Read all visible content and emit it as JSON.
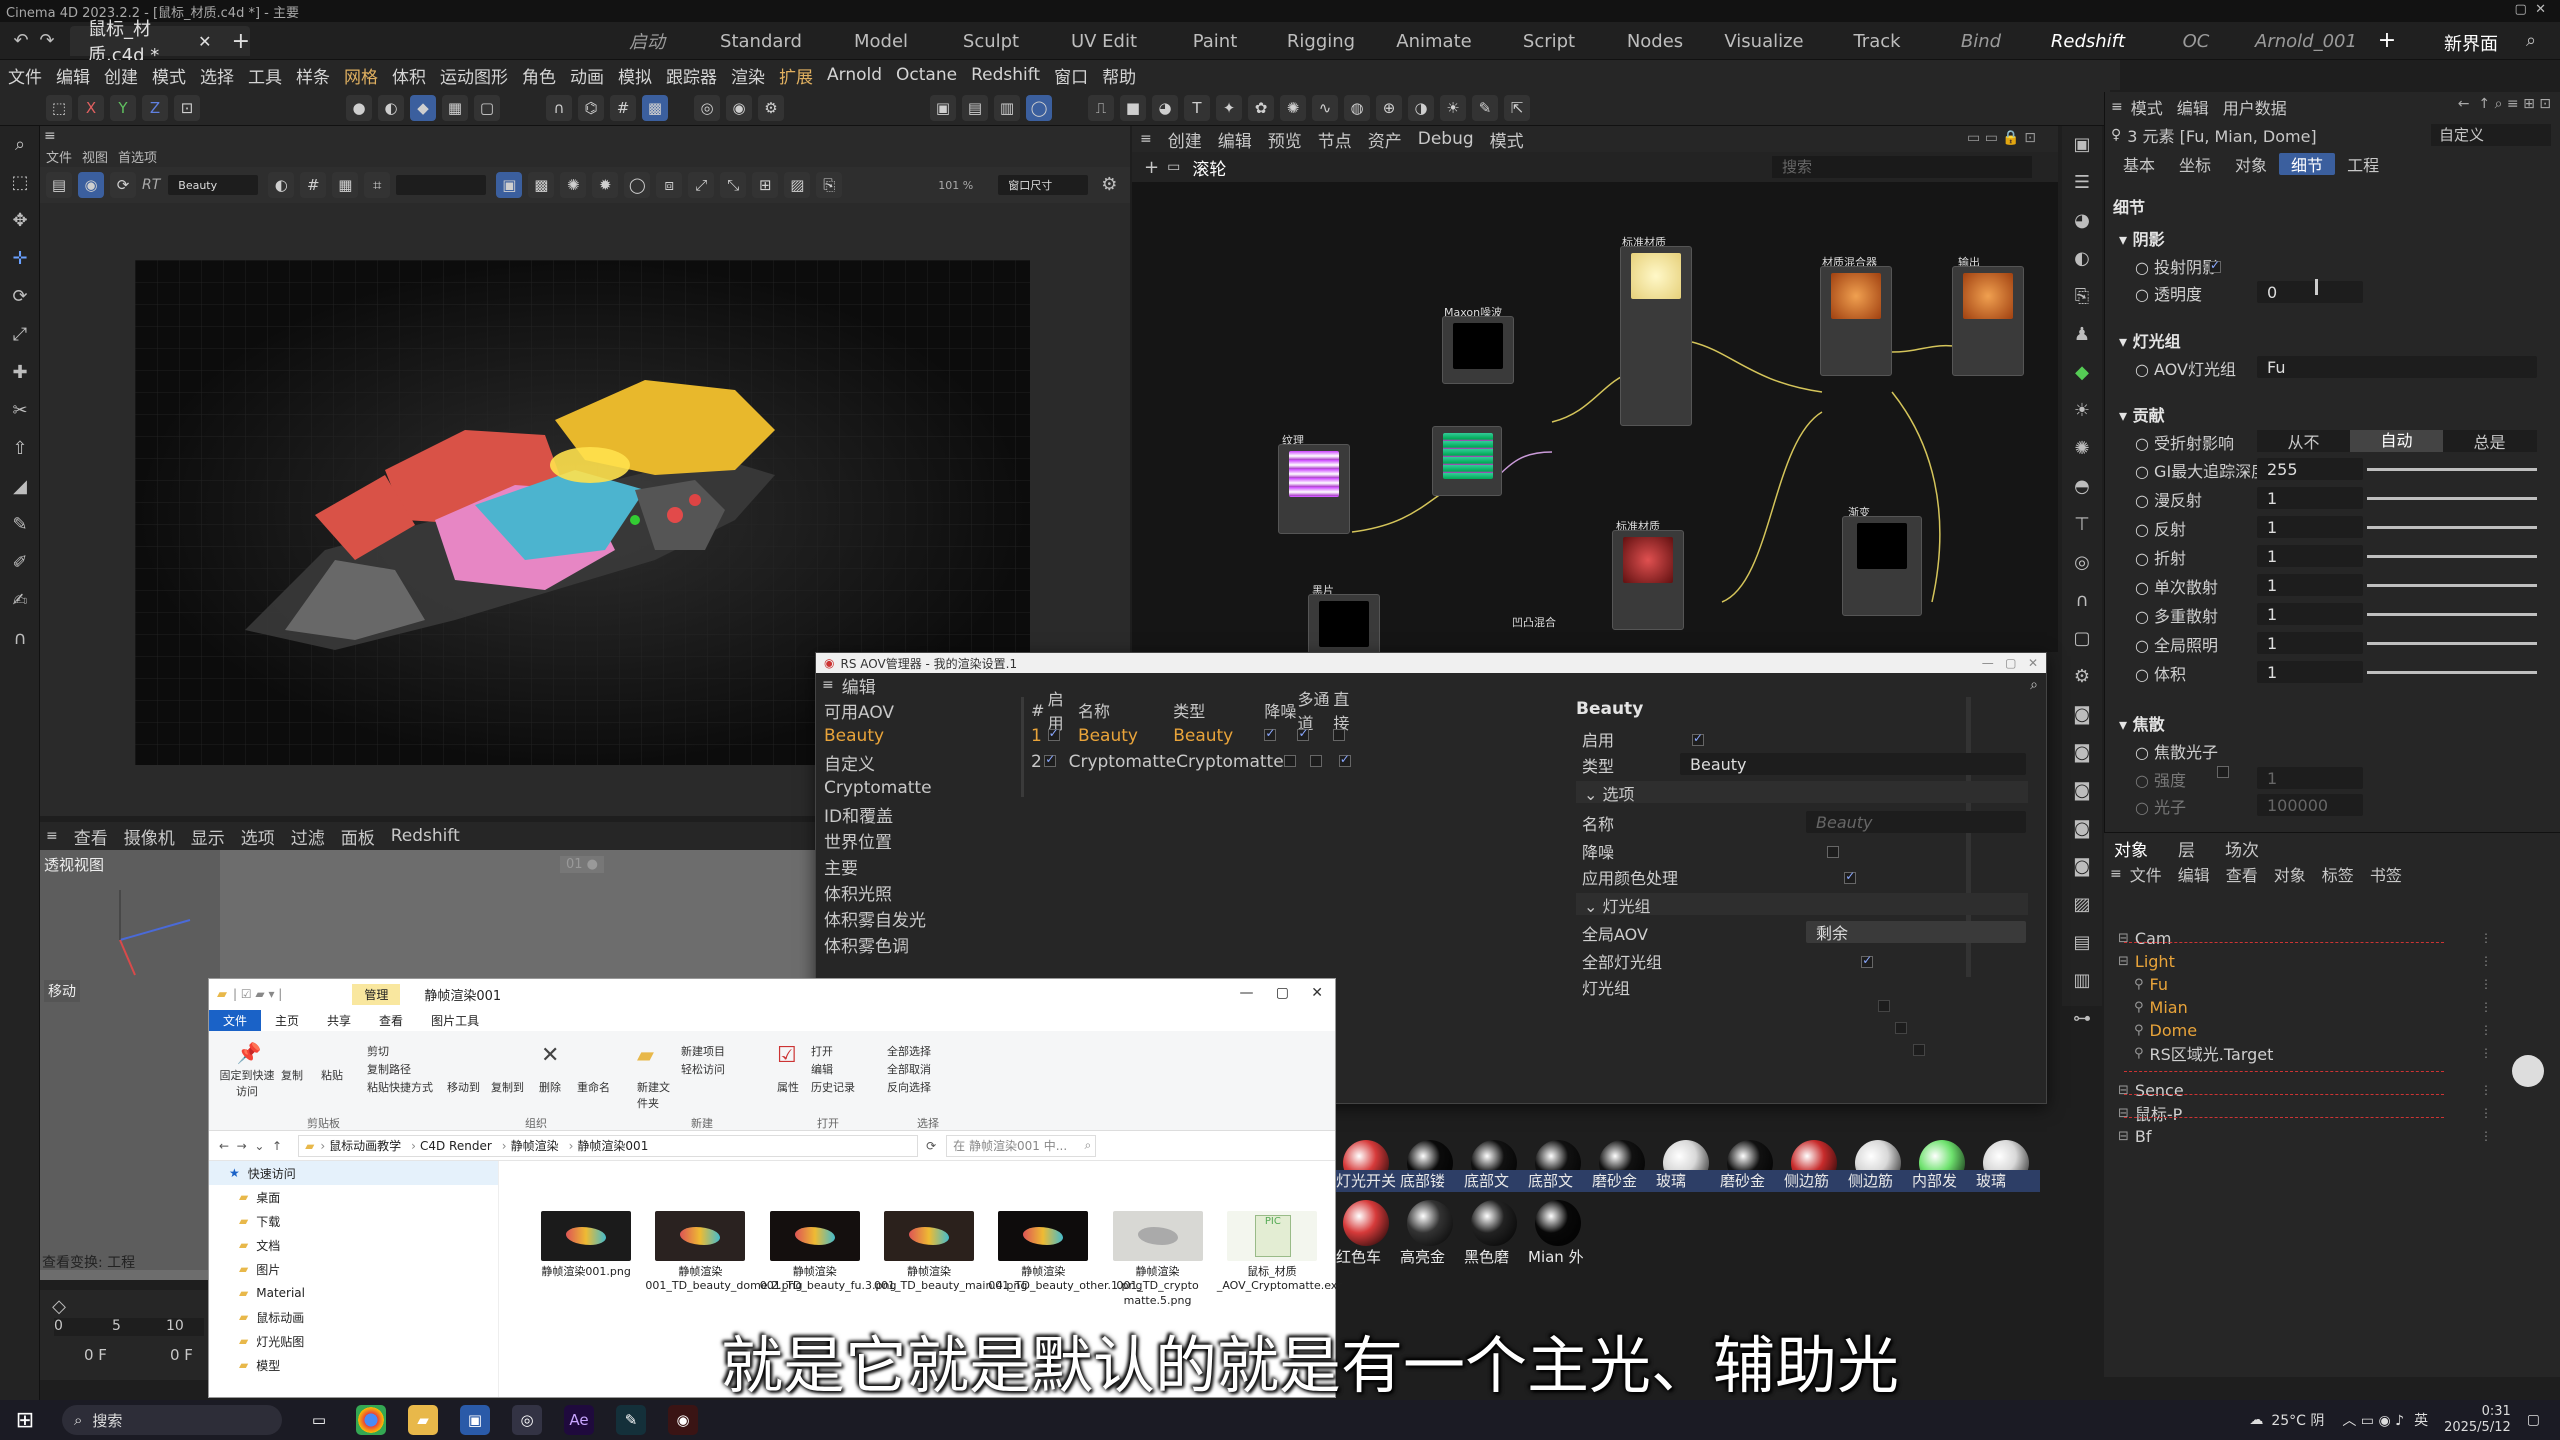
{
  "titlebar": {
    "text": "Cinema 4D 2023.2.2 - [鼠标_材质.c4d *] - 主要"
  },
  "document_tab": {
    "label": "鼠标_材质.c4d *"
  },
  "layouts": {
    "items": [
      "启动",
      "Standard",
      "Model",
      "Sculpt",
      "UV Edit",
      "Paint",
      "Rigging",
      "Animate",
      "Script",
      "Nodes",
      "Visualize",
      "Track",
      "Bind",
      "Redshift",
      "OC",
      "Arnold_001"
    ],
    "new_layout": "新界面"
  },
  "menubar": {
    "items": [
      "文件",
      "编辑",
      "创建",
      "模式",
      "选择",
      "工具",
      "样条",
      "网格",
      "体积",
      "运动图形",
      "角色",
      "动画",
      "模拟",
      "跟踪器",
      "渲染",
      "扩展",
      "Arnold",
      "Octane",
      "Redshift",
      "窗口",
      "帮助"
    ]
  },
  "toolbar1": {
    "axes": [
      "X",
      "Y",
      "Z"
    ]
  },
  "render_view": {
    "menu": [
      "文件",
      "视图",
      "首选项"
    ],
    "preset": "Beauty",
    "zoom": "101 %",
    "fit": "窗口尺寸"
  },
  "bottom_viewport": {
    "menu": [
      "查看",
      "摄像机",
      "显示",
      "选项",
      "过滤",
      "面板",
      "Redshift"
    ],
    "label": "透视视图",
    "move_label": "移动",
    "speed_label": "查看变换: 工程"
  },
  "node_editor": {
    "menu": [
      "创建",
      "编辑",
      "预览",
      "节点",
      "资产",
      "Debug",
      "模式"
    ],
    "tab": "滚轮",
    "search_placeholder": "搜索",
    "nodes": [
      "标准材质",
      "Maxon噪波",
      "材质混合器",
      "输出",
      "纹理",
      "标准材质",
      "渐变",
      "黑片",
      "凹凸混合"
    ]
  },
  "attr_panel": {
    "menu": [
      "模式",
      "编辑",
      "用户数据"
    ],
    "selection": "3 元素 [Fu, Mian, Dome]",
    "preset": "自定义",
    "tabs": [
      "基本",
      "坐标",
      "对象",
      "细节",
      "工程"
    ],
    "active_tab": "细节",
    "section_title": "细节",
    "shadow": {
      "title": "阴影",
      "cast_label": "投射阴影",
      "transparency_label": "透明度",
      "transparency_value": "0"
    },
    "light_group": {
      "title": "灯光组",
      "aov_label": "AOV灯光组",
      "aov_value": "Fu"
    },
    "contribution": {
      "title": "贡献",
      "gi_label": "受折射影响",
      "gi_options": [
        "从不",
        "自动",
        "总是"
      ],
      "gi_active": "自动",
      "rows": [
        {
          "label": "GI最大追踪深度",
          "value": "255"
        },
        {
          "label": "漫反射",
          "value": "1"
        },
        {
          "label": "反射",
          "value": "1"
        },
        {
          "label": "折射",
          "value": "1"
        },
        {
          "label": "单次散射",
          "value": "1"
        },
        {
          "label": "多重散射",
          "value": "1"
        },
        {
          "label": "全局照明",
          "value": "1"
        },
        {
          "label": "体积",
          "value": "1"
        }
      ]
    },
    "caustics": {
      "title": "焦散",
      "photon_label": "焦散光子",
      "intensity_label": "强度",
      "intensity_value": "1",
      "photons_label": "光子",
      "photons_value": "100000"
    }
  },
  "object_manager": {
    "tabs": [
      "对象",
      "层",
      "场次"
    ],
    "menu": [
      "文件",
      "编辑",
      "查看",
      "对象",
      "标签",
      "书签"
    ],
    "objects": [
      {
        "name": "Cam",
        "indent": 0,
        "color": "#cfcfcf"
      },
      {
        "name": "Light",
        "indent": 0,
        "color": "#e9a43a"
      },
      {
        "name": "Fu",
        "indent": 1,
        "color": "#e9a43a"
      },
      {
        "name": "Mian",
        "indent": 1,
        "color": "#e9a43a"
      },
      {
        "name": "Dome",
        "indent": 1,
        "color": "#e9a43a"
      },
      {
        "name": "RS区域光.Target",
        "indent": 1,
        "color": "#cfcfcf"
      },
      {
        "name": "Sence",
        "indent": 0,
        "color": "#cfcfcf"
      },
      {
        "name": "鼠标-P",
        "indent": 0,
        "color": "#cfcfcf"
      },
      {
        "name": "Bf",
        "indent": 0,
        "color": "#cfcfcf"
      }
    ]
  },
  "aov_dialog": {
    "title": "RS AOV管理器 - 我的渲染设置.1",
    "menu": "编辑",
    "available_header": "可用AOV",
    "available": [
      "Beauty",
      "自定义",
      "Cryptomatte",
      "ID和覆盖",
      "世界位置",
      "主要",
      "体积光照",
      "体积雾自发光",
      "体积雾色调"
    ],
    "columns": [
      "#",
      "启用",
      "名称",
      "类型",
      "降噪",
      "多通道",
      "直接"
    ],
    "rows": [
      {
        "num": "1",
        "name": "Beauty",
        "type": "Beauty"
      },
      {
        "num": "2",
        "name": "Cryptomatte",
        "type": "Cryptomatte"
      }
    ],
    "detail": {
      "title": "Beauty",
      "enabled_label": "启用",
      "type_label": "类型",
      "type_value": "Beauty",
      "options_label": "选项",
      "name_label": "名称",
      "name_placeholder": "Beauty",
      "denoise_label": "降噪",
      "color_label": "应用颜色处理",
      "lightgroups_label": "灯光组",
      "global_aov_label": "全局AOV",
      "global_aov_value": "剩余",
      "all_lightgroups_label": "全部灯光组",
      "lightgroup_label": "灯光组"
    }
  },
  "explorer": {
    "title": "静帧渲染001",
    "manage_tab": "管理",
    "tabs": [
      "文件",
      "主页",
      "共享",
      "查看",
      "图片工具"
    ],
    "ribbon_groups": [
      "剪贴板",
      "组织",
      "新建",
      "打开",
      "选择"
    ],
    "ribbon_buttons": [
      "固定到快速访问",
      "复制",
      "粘贴",
      "剪切",
      "复制路径",
      "粘贴快捷方式",
      "移动到",
      "复制到",
      "删除",
      "重命名",
      "新建文件夹",
      "新建项目",
      "轻松访问",
      "属性",
      "打开",
      "编辑",
      "历史记录",
      "全部选择",
      "全部取消",
      "反向选择"
    ],
    "path": [
      "鼠标动画教学",
      "C4D Render",
      "静帧渲染",
      "静帧渲染001"
    ],
    "search_placeholder": "在 静帧渲染001 中...",
    "sidebar": [
      "快速访问",
      "桌面",
      "下载",
      "文档",
      "图片",
      "Material",
      "鼠标动画",
      "灯光贴图",
      "模型"
    ],
    "files": [
      "静帧渲染001.png",
      "静帧渲染001_TD_beauty_dome.2.png",
      "静帧渲染001_TD_beauty_fu.3.png",
      "静帧渲染001_TD_beauty_main.4.png",
      "静帧渲染001_TD_beauty_other.1.png",
      "静帧渲染001_TD_crypto matte.5.png",
      "鼠标_材质_AOV_Cryptomatte.exr"
    ]
  },
  "materials": {
    "row1": [
      "灯光开关",
      "底部镂",
      "底部文",
      "底部文",
      "磨砂金",
      "玻璃",
      "磨砂金",
      "侧边筋",
      "侧边筋",
      "内部发",
      "玻璃"
    ],
    "row2": [
      "红色车",
      "高亮金",
      "黑色磨",
      "Mian 外"
    ]
  },
  "timeline": {
    "start": "0 F",
    "end": "0 F",
    "ticks": [
      "0",
      "5",
      "10"
    ]
  },
  "subtitle": "就是它就是默认的就是有一个主光、辅助光",
  "taskbar": {
    "search": "搜索",
    "weather": "25°C 阴",
    "ime": "英",
    "time": "0:31",
    "date": "2025/5/12"
  },
  "colors": {
    "accent": "#3b5f9e",
    "highlight": "#e9a43a"
  }
}
